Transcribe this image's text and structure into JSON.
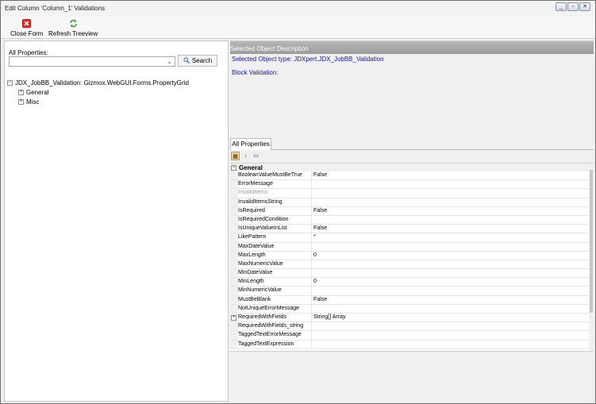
{
  "window": {
    "title": "Edit Column 'Column_1' Validations",
    "controls": [
      "_",
      "▫",
      "✕"
    ]
  },
  "toolbar": {
    "close_label": "Close Form",
    "refresh_label": "Refresh Treeview",
    "close_icon": "close-x-icon",
    "refresh_icon": "refresh-icon",
    "colors": {
      "close": "#d9322c",
      "refresh": "#3aa23a"
    }
  },
  "left": {
    "all_properties_label": "All Properties:",
    "search_value": "",
    "search_button_label": "Search",
    "tree": {
      "root": "JDX_JobBB_Validation: Gizmox.WebGUI.Forms.PropertyGrid",
      "children": [
        "General",
        "Misc"
      ]
    }
  },
  "description": {
    "header": "Selected Object Description",
    "type_line": "Selected Object type: JDXpert.JDX_JobBB_Validation",
    "block_line": "Block Validation:"
  },
  "property_grid": {
    "tab_label": "All Properties",
    "category": "General",
    "rows": [
      {
        "name": "BooleanValueMustBeTrue",
        "value": "False"
      },
      {
        "name": "ErrorMessage",
        "value": ""
      },
      {
        "name": "InvalidItems",
        "value": "",
        "disabled": true
      },
      {
        "name": "InvalidItemsString",
        "value": ""
      },
      {
        "name": "IsRequired",
        "value": "False"
      },
      {
        "name": "IsRequiredCondition",
        "value": ""
      },
      {
        "name": "IsUniqueValueInList",
        "value": "False"
      },
      {
        "name": "LikePattern",
        "value": "*"
      },
      {
        "name": "MaxDateValue",
        "value": ""
      },
      {
        "name": "MaxLength",
        "value": "0"
      },
      {
        "name": "MaxNumericValue",
        "value": ""
      },
      {
        "name": "MinDateValue",
        "value": ""
      },
      {
        "name": "MinLength",
        "value": "0"
      },
      {
        "name": "MinNumericValue",
        "value": ""
      },
      {
        "name": "MustBeBlank",
        "value": "False"
      },
      {
        "name": "NotUniqueErrorMessage",
        "value": ""
      },
      {
        "name": "RequiredWithFields",
        "value": "String[] Array",
        "expandable": true
      },
      {
        "name": "RequiredWithFields_string",
        "value": ""
      },
      {
        "name": "TaggedTextErrorMessage",
        "value": ""
      },
      {
        "name": "TaggedTextExpression",
        "value": ""
      }
    ]
  }
}
